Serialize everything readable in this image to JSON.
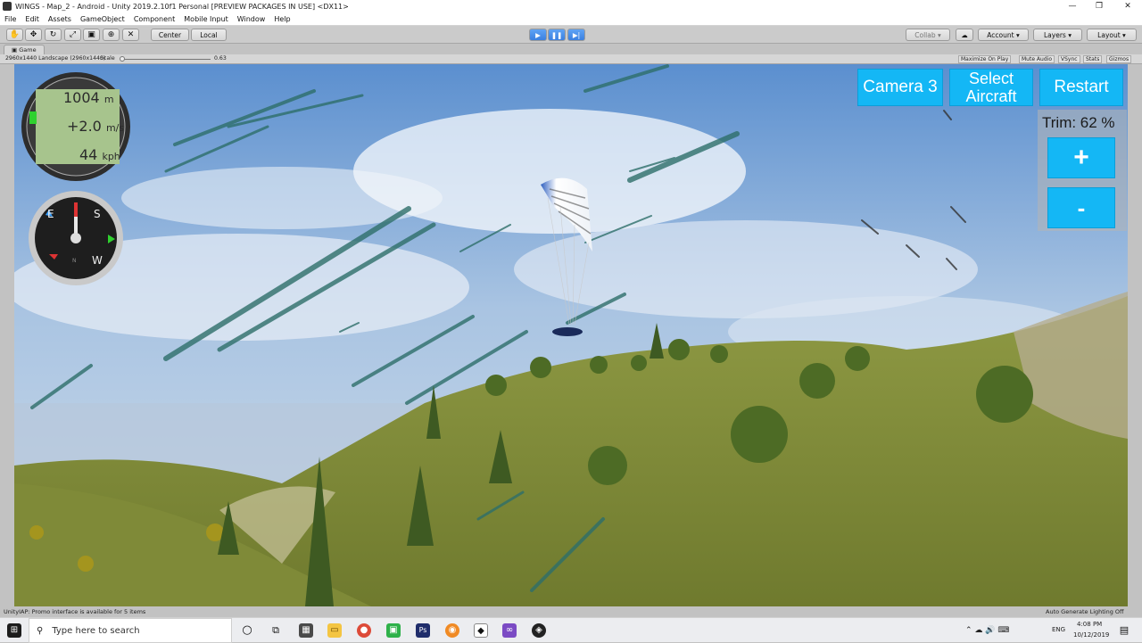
{
  "window": {
    "title": "WINGS - Map_2 - Android - Unity 2019.2.10f1 Personal [PREVIEW PACKAGES IN USE] <DX11>",
    "minimize": "—",
    "maximize": "❐",
    "close": "✕"
  },
  "menu": [
    "File",
    "Edit",
    "Assets",
    "GameObject",
    "Component",
    "Mobile Input",
    "Window",
    "Help"
  ],
  "toolbar": {
    "pivot": "Center",
    "space": "Local",
    "collab": "Collab ▾",
    "account": "Account",
    "layers": "Layers",
    "layout": "Layout"
  },
  "game_tab": {
    "label": "Game"
  },
  "game_bar": {
    "resolution": "2960x1440 Landscape (2960x1440)",
    "scale_label": "Scale",
    "scale_value": "0.63",
    "maximize": "Maximize On Play",
    "mute": "Mute Audio",
    "vsync": "VSync",
    "stats": "Stats",
    "gizmos": "Gizmos"
  },
  "hud": {
    "altitude": "1004",
    "altitude_unit": "m",
    "vspeed": "+2.0",
    "vspeed_unit": "m/s",
    "airspeed": "44",
    "airspeed_unit": "kph",
    "camera_label": "Camera 3",
    "select_aircraft_label": "Select Aircraft",
    "restart_label": "Restart",
    "trim_label": "Trim: 62 %",
    "trim_plus": "+",
    "trim_minus": "-",
    "compass": [
      "S",
      "E",
      "W",
      "N"
    ]
  },
  "status": {
    "message": "UnityIAP: Promo interface is available for 5 items",
    "lighting": "Auto Generate Lighting Off"
  },
  "taskbar": {
    "search_placeholder": "Type here to search",
    "language": "ENG",
    "time": "4:08 PM",
    "date": "10/12/2019"
  }
}
